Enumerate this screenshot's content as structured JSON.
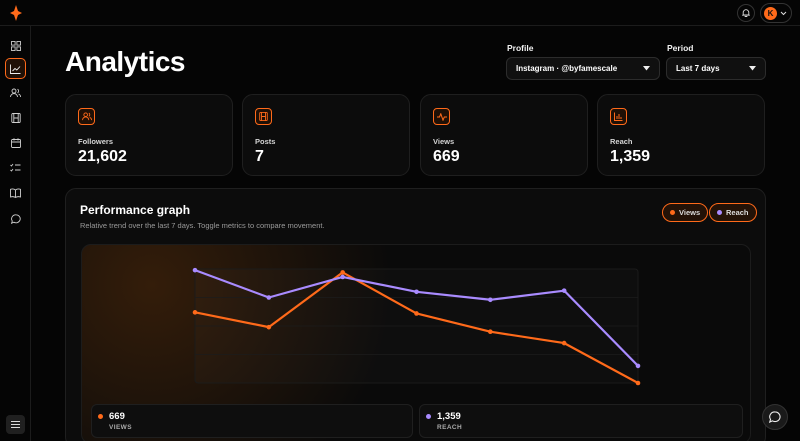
{
  "header": {
    "avatar_initial": "K"
  },
  "page": {
    "title": "Analytics"
  },
  "filters": {
    "profile_label": "Profile",
    "profile_value": "Instagram · @byfamescale",
    "period_label": "Period",
    "period_value": "Last 7 days"
  },
  "stats": [
    {
      "label": "Followers",
      "value": "21,602",
      "icon": "users-icon"
    },
    {
      "label": "Posts",
      "value": "7",
      "icon": "film-icon"
    },
    {
      "label": "Views",
      "value": "669",
      "icon": "activity-icon"
    },
    {
      "label": "Reach",
      "value": "1,359",
      "icon": "bar-chart-icon"
    }
  ],
  "performance": {
    "title": "Performance graph",
    "subtitle": "Relative trend over the last 7 days. Toggle metrics to compare movement.",
    "toggles": {
      "views": "Views",
      "reach": "Reach"
    },
    "legend": {
      "views_value": "669",
      "views_caption": "VIEWS",
      "reach_value": "1,359",
      "reach_caption": "REACH"
    }
  },
  "colors": {
    "views": "#ff6a1a",
    "reach": "#a98bff",
    "accent": "#ff6a1a"
  },
  "chart_data": {
    "type": "line",
    "x": [
      1,
      2,
      3,
      4,
      5,
      6,
      7
    ],
    "ylim": [
      0,
      1
    ],
    "grid": true,
    "series": [
      {
        "name": "Views",
        "values": [
          0.62,
          0.49,
          0.97,
          0.61,
          0.45,
          0.35,
          0.0
        ]
      },
      {
        "name": "Reach",
        "values": [
          0.99,
          0.75,
          0.93,
          0.8,
          0.73,
          0.81,
          0.15
        ]
      }
    ]
  }
}
